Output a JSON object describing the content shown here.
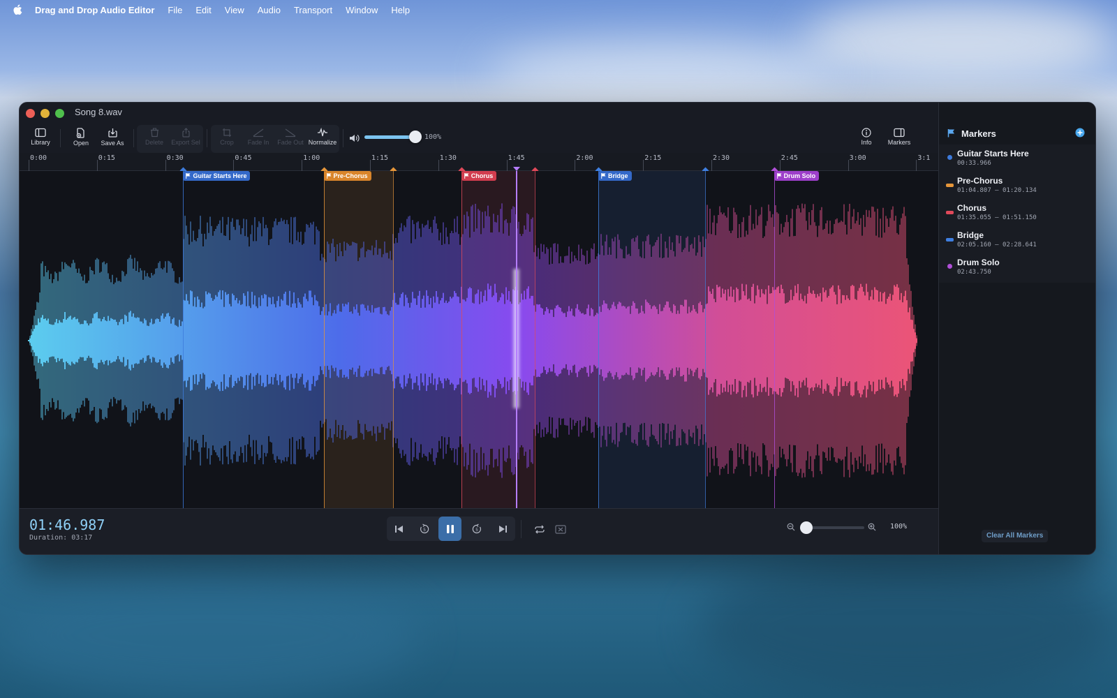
{
  "menubar": {
    "app_name": "Drag and Drop Audio Editor",
    "items": [
      "File",
      "Edit",
      "View",
      "Audio",
      "Transport",
      "Window",
      "Help"
    ]
  },
  "window": {
    "title": "Song 8.wav"
  },
  "toolbar": {
    "library": "Library",
    "open": "Open",
    "save_as": "Save As",
    "delete": "Delete",
    "export_sel": "Export Sel",
    "crop": "Crop",
    "fade_in": "Fade In",
    "fade_out": "Fade Out",
    "normalize": "Normalize",
    "volume_pct": "100%",
    "volume_level": 1.0,
    "info": "Info",
    "markers": "Markers"
  },
  "ruler": {
    "labels": [
      "0:00",
      "0:15",
      "0:30",
      "0:45",
      "1:00",
      "1:15",
      "1:30",
      "1:45",
      "2:00",
      "2:15",
      "2:30",
      "2:45",
      "3:00",
      "3:1"
    ]
  },
  "markers": [
    {
      "name": "Guitar Starts Here",
      "time": "00:33.966",
      "start": 33.966,
      "end": null,
      "color": "#3d7bdc",
      "tagcolor": "#3469c9"
    },
    {
      "name": "Pre-Chorus",
      "time": "01:04.807 — 01:20.134",
      "start": 64.807,
      "end": 80.134,
      "color": "#e6963a",
      "tagcolor": "#d9852b"
    },
    {
      "name": "Chorus",
      "time": "01:35.055 — 01:51.150",
      "start": 95.055,
      "end": 111.15,
      "color": "#e0495a",
      "tagcolor": "#d23d4f"
    },
    {
      "name": "Bridge",
      "time": "02:05.160 — 02:28.641",
      "start": 125.16,
      "end": 148.641,
      "color": "#3f7fe0",
      "tagcolor": "#3469c9"
    },
    {
      "name": "Drum Solo",
      "time": "02:43.750",
      "start": 163.75,
      "end": null,
      "color": "#b04fd8",
      "tagcolor": "#9d3fca"
    }
  ],
  "playback": {
    "current_time": "01:46.987",
    "position": 106.987,
    "duration_label": "Duration: 03:17",
    "duration": 197
  },
  "zoom": {
    "pct": "100%",
    "level": 0.0
  },
  "sidebar": {
    "title": "Markers",
    "clear_label": "Clear All Markers"
  },
  "colors": {
    "accent": "#8fd0f7",
    "wave_start": "#5fd3f5",
    "wave_mid": "#8b4cf5",
    "wave_end": "#f2567a"
  }
}
